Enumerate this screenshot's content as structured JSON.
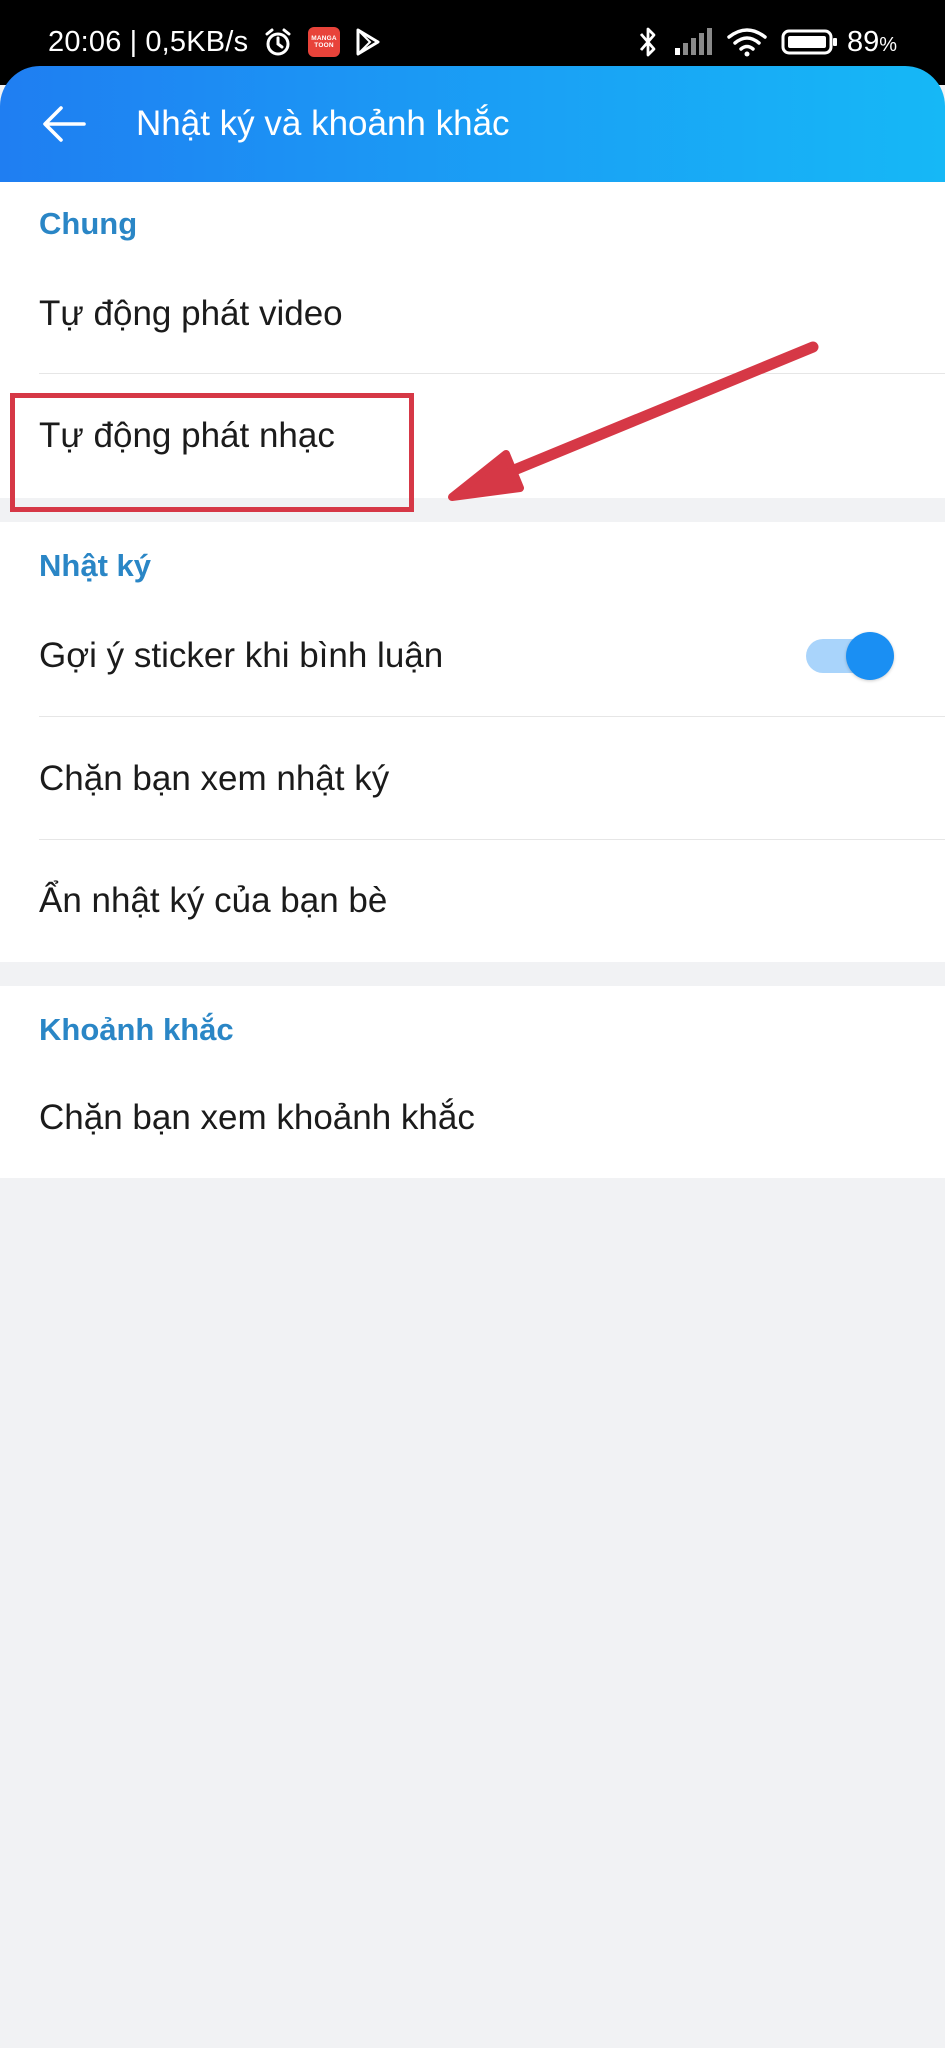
{
  "status_bar": {
    "time": "20:06",
    "separator": "|",
    "net_speed": "0,5KB/s",
    "app_badge_line1": "MANGA",
    "app_badge_line2": "TOON",
    "battery_percent": "89",
    "battery_unit": "%",
    "icons": [
      "alarm-icon",
      "manga-toon-app-icon",
      "play-store-icon",
      "bluetooth-icon",
      "signal-icon",
      "wifi-icon",
      "battery-icon"
    ]
  },
  "header": {
    "title": "Nhật ký và khoảnh khắc",
    "back_icon": "arrow-left-icon"
  },
  "sections": {
    "general": {
      "title": "Chung",
      "items": [
        {
          "label": "Tự động phát video"
        },
        {
          "label": "Tự động phát nhạc"
        }
      ]
    },
    "diary": {
      "title": "Nhật ký",
      "items": [
        {
          "label": "Gợi ý sticker khi bình luận",
          "toggle": true
        },
        {
          "label": "Chặn bạn xem nhật ký"
        },
        {
          "label": "Ẩn nhật ký của bạn bè"
        }
      ]
    },
    "moments": {
      "title": "Khoảnh khắc",
      "items": [
        {
          "label": "Chặn bạn xem khoảnh khắc"
        }
      ]
    }
  },
  "colors": {
    "header_gradient_start": "#1f7ef2",
    "header_gradient_end": "#16b8f6",
    "section_title": "#2a86c6",
    "toggle_on": "#1a8ff3",
    "annotation": "#d63846",
    "page_background": "#f1f2f4"
  }
}
